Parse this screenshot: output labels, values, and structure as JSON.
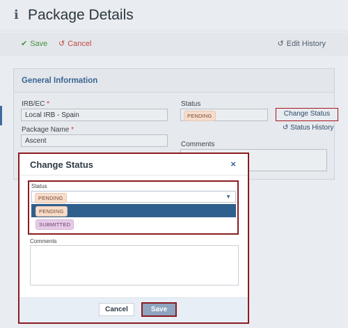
{
  "header": {
    "title": "Package Details",
    "icon": "info-icon"
  },
  "toolbar": {
    "save_label": "Save",
    "cancel_label": "Cancel",
    "history_label": "Edit History",
    "colors": {
      "save": "#4a8f3c",
      "cancel": "#c4453c"
    }
  },
  "panel": {
    "title": "General Information",
    "irb_label": "IRB/EC",
    "irb_value": "Local IRB - Spain",
    "package_name_label": "Package Name",
    "package_name_value": "Ascent",
    "status_label": "Status",
    "status_value": "PENDING",
    "change_status_label": "Change Status",
    "status_history_label": "Status History",
    "comments_label": "Comments",
    "required_marker": "*"
  },
  "modal": {
    "title": "Change Status",
    "close_icon": "×",
    "status_label": "Status",
    "selected_value": "PENDING",
    "options": [
      {
        "label": "PENDING",
        "highlighted": true
      },
      {
        "label": "SUBMITTED",
        "highlighted": false
      }
    ],
    "comments_label": "Comments",
    "cancel_label": "Cancel",
    "save_label": "Save"
  },
  "colors": {
    "accent": "#3a6591",
    "highlight_border": "#8b1b1f",
    "pending_pill": "#f6dccb",
    "submitted_pill": "#e6cbe6",
    "option_selected_bg": "#2f5f8d"
  }
}
